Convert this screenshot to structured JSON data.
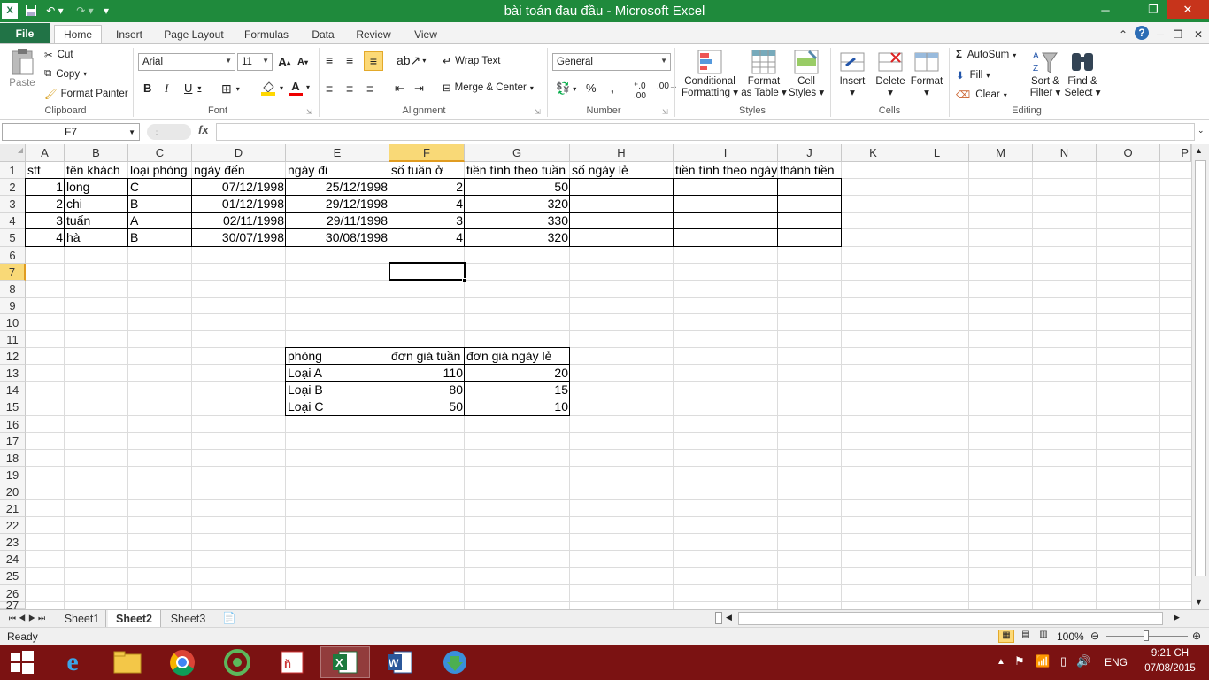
{
  "window": {
    "title": "bài toán đau đầu  -  Microsoft Excel"
  },
  "tabs": [
    "File",
    "Home",
    "Insert",
    "Page Layout",
    "Formulas",
    "Data",
    "Review",
    "View"
  ],
  "ribbon": {
    "clipboard": {
      "paste": "Paste",
      "cut": "Cut",
      "copy": "Copy",
      "format_painter": "Format Painter",
      "label": "Clipboard"
    },
    "font": {
      "name": "Arial",
      "size": "11",
      "label": "Font"
    },
    "alignment": {
      "wrap_text": "Wrap Text",
      "merge_center": "Merge & Center",
      "label": "Alignment"
    },
    "number": {
      "format": "General",
      "label": "Number"
    },
    "styles": {
      "conditional": [
        "Conditional",
        "Formatting"
      ],
      "format_table": [
        "Format",
        "as Table"
      ],
      "cell_styles": [
        "Cell",
        "Styles"
      ],
      "label": "Styles"
    },
    "cells": {
      "insert": "Insert",
      "delete": "Delete",
      "format": "Format",
      "label": "Cells"
    },
    "editing": {
      "autosum": "AutoSum",
      "fill": "Fill",
      "clear": "Clear",
      "sort_filter": [
        "Sort &",
        "Filter"
      ],
      "find_select": [
        "Find &",
        "Select"
      ],
      "label": "Editing"
    }
  },
  "formula_bar": {
    "name_box": "F7",
    "fx": "fx",
    "value": ""
  },
  "columns": [
    "A",
    "B",
    "C",
    "D",
    "E",
    "F",
    "G",
    "H",
    "I",
    "J",
    "K",
    "L",
    "M",
    "N",
    "O",
    "P"
  ],
  "rows": [
    "1",
    "2",
    "3",
    "4",
    "5",
    "6",
    "7",
    "8",
    "9",
    "10",
    "11",
    "12",
    "13",
    "14",
    "15",
    "16",
    "17",
    "18",
    "19",
    "20",
    "21",
    "22",
    "23",
    "24",
    "25",
    "26",
    "27"
  ],
  "table1": {
    "headers": [
      "stt",
      "tên khách",
      "loại phòng",
      "ngày đến",
      "ngày đi",
      "số tuần ở",
      "tiền tính theo tuần",
      "số ngày lẻ",
      "tiền tính theo ngày",
      "thành tiền"
    ],
    "rows": [
      [
        "1",
        "long",
        "C",
        "07/12/1998",
        "25/12/1998",
        "2",
        "50",
        "",
        "",
        ""
      ],
      [
        "2",
        "chi",
        "B",
        "01/12/1998",
        "29/12/1998",
        "4",
        "320",
        "",
        "",
        ""
      ],
      [
        "3",
        "tuấn",
        "A",
        "02/11/1998",
        "29/11/1998",
        "3",
        "330",
        "",
        "",
        ""
      ],
      [
        "4",
        "hà",
        "B",
        "30/07/1998",
        "30/08/1998",
        "4",
        "320",
        "",
        "",
        ""
      ]
    ]
  },
  "table2": {
    "headers": [
      "phòng",
      "đơn giá tuần",
      "đơn giá ngày lẻ"
    ],
    "rows": [
      [
        "Loại A",
        "110",
        "20"
      ],
      [
        "Loại B",
        "80",
        "15"
      ],
      [
        "Loại C",
        "50",
        "10"
      ]
    ]
  },
  "sheets": [
    "Sheet1",
    "Sheet2",
    "Sheet3"
  ],
  "active_sheet": "Sheet2",
  "status": {
    "ready": "Ready",
    "zoom": "100%"
  },
  "taskbar": {
    "lang": "ENG",
    "time": "9:21 CH",
    "date": "07/08/2015"
  },
  "colors": {
    "excel_green": "#217346",
    "title_green": "#1f8a3c",
    "taskbar": "#7b1212",
    "selection": "#f9d977"
  }
}
